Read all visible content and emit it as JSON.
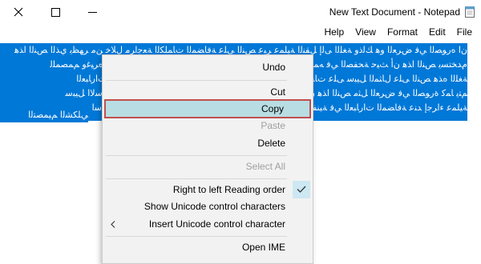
{
  "window": {
    "title": "New Text Document - Notepad",
    "close_icon": "close-icon",
    "maximize_icon": "maximize-icon",
    "minimize_icon": "minimize-icon",
    "app_icon": "notepad-icon"
  },
  "menubar": {
    "items": [
      "File",
      "Edit",
      "Format",
      "View",
      "Help"
    ]
  },
  "editor": {
    "selection_color": "#0078d7",
    "lines": [
      "ﻥﺍ ﻩﺭﻮﺼﻟﺍ ﻲﻓ ﺽﺮﻌﻟﺍ ﻭﻫ ﻚﻟﺫﻭ ﺔﻐﻠﻟﺍ ﻰﻟﺇ ﻞﻘﻨﻟﺍ ﺔﻴﻠﻤﻋ ﺮﺒﻋ ﺺﻨﻟﺍ ﻰﻠﻋ ﺔﻓﺎﻀﻤﻟﺍ ﺕﺎﻤﻠﻜﻟﺍ ﺔﻌﺟﺍﺮﻣ ﻝﻼﺧ ﻦﻣ ﺮﻬﻈﻳ ﻱﺬﻟﺍ ﺺﻨﻟﺍ ﺍﺬﻫ",
      "ﻡﺪﺨﺘﺴﻳ ﺺﻨﻟﺍ ﺍﺬﻫ ﻥﺃ ﺚﻴﺣ ﺔﺤﻔﺼﻟﺍ ﻲﻓ ﻪﻤﻴﻤﺼﺗ ﺩﺍﺮﻤﻟﺍ ﻞﻜﺸﻟﺍ ﻰﻠﻋ ﻝﻮﺼﺤﻠﻟ ﺔﻴﻠﻜﺸﻟﺍ ﺕﺎﻤﻴﻤﺼﺘﻟﺍ ﻲﻓ ﻩﺮﻴﻏﻭ ﻢﻤﺼﻤﻠﻟ",
      "ﺔﻐﻠﻟﺍ ﻩﺬﻫ ﺺﻨﻟﺍ ﻰﻠﻋ ﻝﺎﺜﻤﻟﺍ ﻞﻴﺒﺳ ﻰﻠﻋ ﺕﺎﺤﻔﺼﻟﺍ ﻲﻓ ﺔﻴﻠﻤﻌﻟﺍ ﻩﺬﻫ ﻞﺜﻣ ﻡﺍﺪﺨﺘﺳﺍ ﻦﻜﻤﻳ ﺚﻴﺣ ﺔﻓﺎﻀﻤﻟﺍ ﺕﺍﺭﺎﺒﻌﻟﺍ",
      "ﻢﺘﻳ ﺎﻤﻛ ﺓﺭﻮﺼﻟﺍ ﻲﻓ ﺽﺮﻌﻟﺍ ﻞﺜﻣ ﺺﻨﻟﺍ ﺍﺬﻫ ﻥﺇ ﺕﺎﻤﻠﻜﻟﺍ ﻂﻴﺴﺒﺗ ﻞﺟﺃ ﻦﻣ ﻲﻠﻜﺸﻟﺍ ﻢﻴﻤﺼﺘﻟﺍ ﻲﻓ ﻪﻨﻣ ﺓﺩﺎﻔﺘﺳﻻﺍ ﻞﻴﺒﺳ",
      "ﺔﻴﻠﻤﻋ ﺀﺍﺮﺟﺇ ﺪﻨﻋ ﺔﻓﺎﻀﻤﻟﺍ ﺕﺍﺭﺎﺒﻌﻟﺍ ﻲﻓ ﺔﻴﻨﻔﻟﺍ ﺕﺎﻳﻮﺘﺴﻤﻟﺍ ﻲﻓ ﻲﻠﻜﺸﻟﺍ ﻪﻤﻴﻤﺼﺗ ﻲﻓ ﺹﻮﺼﻨﻟﺍ ﻩﺬﻫ ﻝﺎﻤﻌﺘﺳﺍ",
      "ﻲﻠﻜﺸﻟﺍ ﻢﻴﻤﺼﺘﻟﺍ"
    ]
  },
  "context_menu": {
    "items": [
      {
        "label": "Undo",
        "enabled": true
      },
      {
        "label": "Cut",
        "enabled": true
      },
      {
        "label": "Copy",
        "enabled": true,
        "highlighted": true
      },
      {
        "label": "Paste",
        "enabled": false
      },
      {
        "label": "Delete",
        "enabled": true
      },
      {
        "label": "Select All",
        "enabled": false
      },
      {
        "label": "Right to left Reading order",
        "enabled": true,
        "checked": true
      },
      {
        "label": "Show Unicode control characters",
        "enabled": true
      },
      {
        "label": "Insert Unicode control character",
        "enabled": true,
        "submenu": true
      },
      {
        "label": "Open IME",
        "enabled": true
      }
    ],
    "highlight_border_color": "#c0504d",
    "highlight_fill_color": "#b8dde3"
  }
}
